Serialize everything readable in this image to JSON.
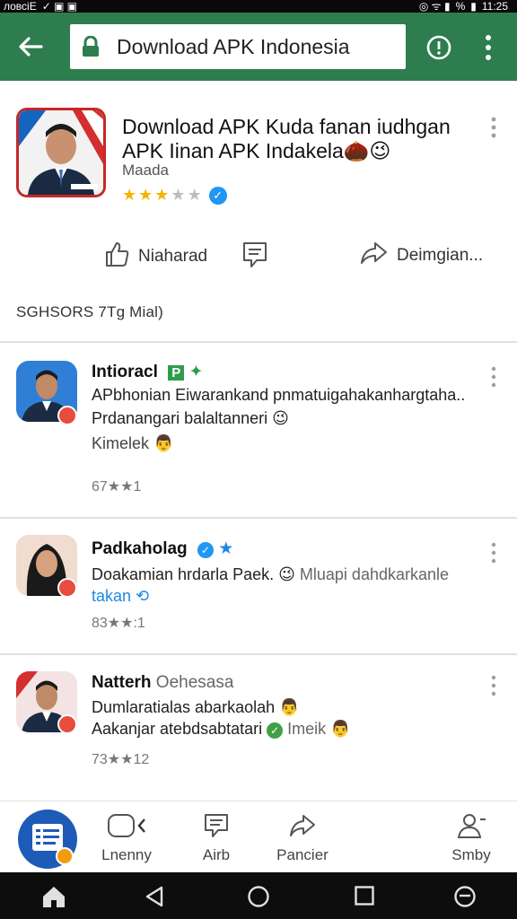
{
  "status_bar": {
    "left_text": "ловсіЕ",
    "battery": "%",
    "time": "11:25"
  },
  "app_bar": {
    "url_text": "Download APK Indonesia"
  },
  "app_header": {
    "title_line1": "Download APK Kuda fanan iudhgan",
    "title_line2": "APK Iinan APK Indakela",
    "title_emojis": "🌰😉",
    "subtitle": "Maada",
    "rating_stars_filled": 3,
    "rating_stars_total": 5,
    "verified_icon": "check-icon"
  },
  "actions": {
    "download_label": "Niaharad",
    "comment_label": "",
    "share_label": "Deimgian..."
  },
  "section_label": "SGHSORS 7Tg Mial)",
  "posts": [
    {
      "name": "Intioracl",
      "name_badge": "P",
      "line1": "APbhonian Eiwarankand pnmatuigahakanharg​taha..",
      "line2": "Prdanangari balaltanneri",
      "line2_emoji": "😉",
      "line3": "Kimelek",
      "line3_emoji": "👨",
      "meta": "67★★1"
    },
    {
      "name": "Padkaholag",
      "name_extra": "",
      "line1": "Doakamian hrdarla Paek.",
      "line1_emoji": "😉",
      "line1_rest": "Mluapi dahdkarkanle",
      "line2": "takan",
      "meta": "83★★:1"
    },
    {
      "name": "Natterh",
      "name_extra": "Oehesasa",
      "line1": "Dumlaratialas abarkaolah",
      "line1_emoji": "👨",
      "line2": "Aakanjar atebdsabtatari",
      "line2_rest": "Imeik",
      "line2_emoji": "👨",
      "meta": "73★★12"
    }
  ],
  "bottom_nav": {
    "items": [
      {
        "label": "Lnenny"
      },
      {
        "label": "Airb"
      },
      {
        "label": "Pancier"
      },
      {
        "label": "Smby"
      }
    ]
  },
  "colors": {
    "app_bar": "#2e7d4f",
    "accent_blue": "#1e88e5",
    "star": "#f4b400"
  }
}
